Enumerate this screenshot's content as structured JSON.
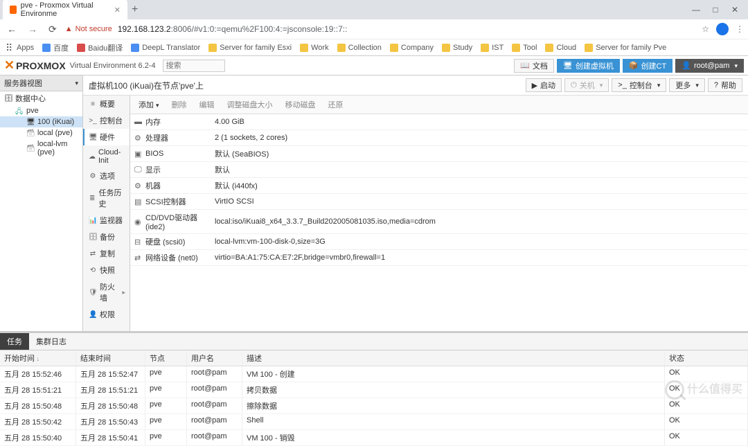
{
  "browser": {
    "tab_title": "pve - Proxmox Virtual Environme",
    "window_controls": {
      "min": "—",
      "max": "□",
      "close": "✕"
    },
    "nav": {
      "back": "←",
      "fwd": "→",
      "reload": "⟳"
    },
    "secure_label": "Not secure",
    "url_host": "192.168.123.2",
    "url_path": ":8006/#v1:0:=qemu%2F100:4:=jsconsole:19::7::",
    "avatar_initial": ""
  },
  "bookmarks": [
    {
      "label": "Apps",
      "cls": "apps"
    },
    {
      "label": "百度",
      "cls": "blue"
    },
    {
      "label": "Baidu翻译",
      "cls": "red"
    },
    {
      "label": "DeepL Translator",
      "cls": "blue"
    },
    {
      "label": "Server for family Esxi",
      "cls": ""
    },
    {
      "label": "Work",
      "cls": ""
    },
    {
      "label": "Collection",
      "cls": ""
    },
    {
      "label": "Company",
      "cls": ""
    },
    {
      "label": "Study",
      "cls": ""
    },
    {
      "label": "IST",
      "cls": ""
    },
    {
      "label": "Tool",
      "cls": ""
    },
    {
      "label": "Cloud",
      "cls": ""
    },
    {
      "label": "Server for family Pve",
      "cls": ""
    }
  ],
  "px": {
    "logo": "PROXMOX",
    "version": "Virtual Environment 6.2-4",
    "search_ph": "搜索",
    "buttons": {
      "docs": "文档",
      "create_vm": "创建虚拟机",
      "create_ct": "创建CT",
      "user": "root@pam"
    }
  },
  "leftpane": {
    "title": "服务器视图",
    "tree": {
      "datacenter": "数据中心",
      "node": "pve",
      "vm": "100 (iKuai)",
      "storage1": "local (pve)",
      "storage2": "local-lvm (pve)"
    }
  },
  "vm": {
    "title": "虚拟机100 (iKuai)在节点'pve'上",
    "actions": {
      "start": "启动",
      "shutdown": "关机",
      "console": "控制台",
      "more": "更多",
      "help": "帮助"
    }
  },
  "sidenav": [
    {
      "icon": "≡",
      "label": "概要"
    },
    {
      "icon": ">_",
      "label": "控制台"
    },
    {
      "icon": "🖥",
      "label": "硬件",
      "active": true
    },
    {
      "icon": "☁",
      "label": "Cloud-Init"
    },
    {
      "icon": "⚙",
      "label": "选项"
    },
    {
      "icon": "≣",
      "label": "任务历史"
    },
    {
      "icon": "📊",
      "label": "监视器"
    },
    {
      "icon": "🗄",
      "label": "备份"
    },
    {
      "icon": "⇄",
      "label": "复制"
    },
    {
      "icon": "⟲",
      "label": "快照"
    },
    {
      "icon": "🛡",
      "label": "防火墙",
      "chev": "▸"
    },
    {
      "icon": "👤",
      "label": "权限"
    }
  ],
  "toolbar": {
    "add": "添加",
    "remove": "删除",
    "edit": "编辑",
    "resize": "调整磁盘大小",
    "move": "移动磁盘",
    "revert": "还原"
  },
  "hardware": [
    {
      "icon": "▬",
      "name": "内存",
      "value": "4.00 GiB"
    },
    {
      "icon": "⚙",
      "name": "处理器",
      "value": "2 (1 sockets, 2 cores)"
    },
    {
      "icon": "▣",
      "name": "BIOS",
      "value": "默认 (SeaBIOS)"
    },
    {
      "icon": "🖵",
      "name": "显示",
      "value": "默认"
    },
    {
      "icon": "⚙",
      "name": "机器",
      "value": "默认 (i440fx)"
    },
    {
      "icon": "▤",
      "name": "SCSI控制器",
      "value": "VirtIO SCSI"
    },
    {
      "icon": "◉",
      "name": "CD/DVD驱动器 (ide2)",
      "value": "local:iso/iKuai8_x64_3.3.7_Build202005081035.iso,media=cdrom"
    },
    {
      "icon": "⊟",
      "name": "硬盘 (scsi0)",
      "value": "local-lvm:vm-100-disk-0,size=3G"
    },
    {
      "icon": "⇄",
      "name": "网络设备 (net0)",
      "value": "virtio=BA:A1:75:CA:E7:2F,bridge=vmbr0,firewall=1"
    }
  ],
  "log": {
    "tab_tasks": "任务",
    "tab_cluster": "集群日志",
    "headers": {
      "start": "开始时间",
      "end": "结束时间",
      "node": "节点",
      "user": "用户名",
      "desc": "描述",
      "status": "状态"
    },
    "rows": [
      {
        "start": "五月 28 15:52:46",
        "end": "五月 28 15:52:47",
        "node": "pve",
        "user": "root@pam",
        "desc": "VM 100 - 创建",
        "status": "OK"
      },
      {
        "start": "五月 28 15:51:21",
        "end": "五月 28 15:51:21",
        "node": "pve",
        "user": "root@pam",
        "desc": "拷贝数据",
        "status": "OK"
      },
      {
        "start": "五月 28 15:50:48",
        "end": "五月 28 15:50:48",
        "node": "pve",
        "user": "root@pam",
        "desc": "擦除数据",
        "status": "OK"
      },
      {
        "start": "五月 28 15:50:42",
        "end": "五月 28 15:50:43",
        "node": "pve",
        "user": "root@pam",
        "desc": "Shell",
        "status": "OK"
      },
      {
        "start": "五月 28 15:50:40",
        "end": "五月 28 15:50:41",
        "node": "pve",
        "user": "root@pam",
        "desc": "VM 100 - 销毁",
        "status": "OK"
      }
    ]
  },
  "watermark": "什么值得买"
}
